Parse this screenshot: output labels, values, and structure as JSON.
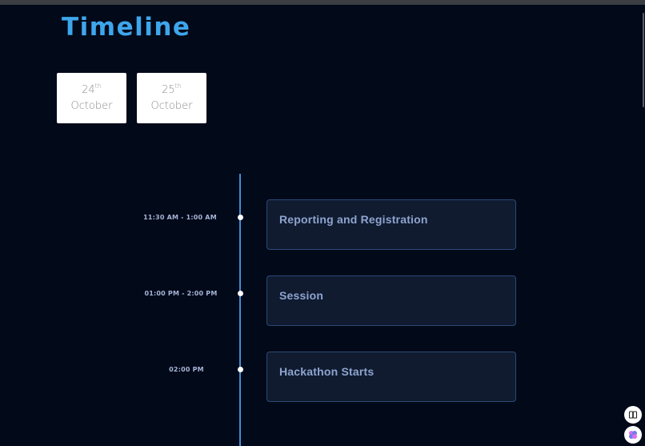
{
  "page": {
    "title": "Timeline"
  },
  "dates": [
    {
      "day": "24",
      "suffix": "th",
      "month": "October"
    },
    {
      "day": "25",
      "suffix": "th",
      "month": "October"
    }
  ],
  "events": [
    {
      "time": "11:30 AM - 1:00 AM",
      "label": "Reporting and Registration"
    },
    {
      "time": "01:00 PM - 2:00 PM",
      "label": "Session"
    },
    {
      "time": "02:00 PM",
      "label": "Hackathon Starts"
    }
  ],
  "colors": {
    "background": "#020919",
    "title": "#3ea6ec",
    "timeline_line": "#3f8fd6",
    "card_bg": "#101b30",
    "card_border": "#2a4a74",
    "card_text": "#8ea4cf"
  },
  "floating_buttons": [
    {
      "icon": "book-icon"
    },
    {
      "icon": "palette-icon"
    }
  ]
}
